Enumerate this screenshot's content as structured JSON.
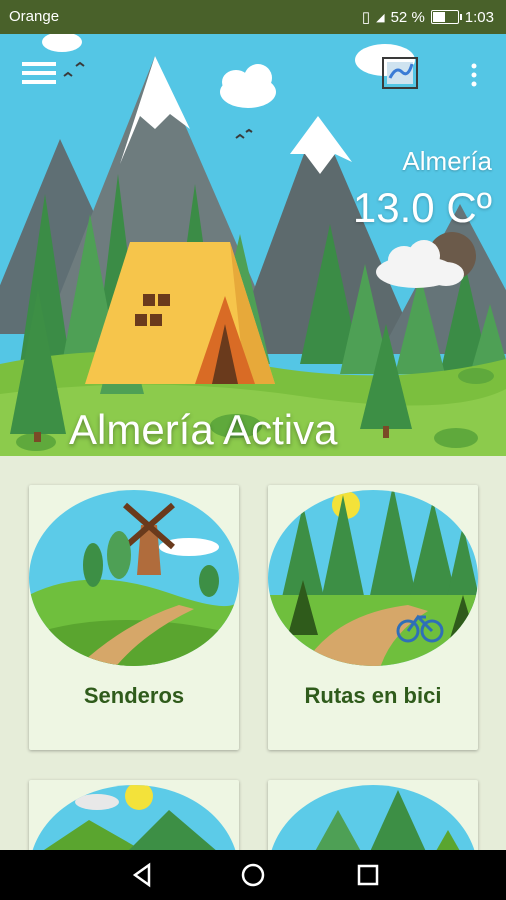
{
  "status_bar": {
    "carrier": "Orange",
    "battery": "52 %",
    "time": "1:03"
  },
  "header": {
    "city": "Almería",
    "temperature": "13.0 Cº",
    "title": "Almería Activa"
  },
  "cards": [
    {
      "label": "Senderos"
    },
    {
      "label": "Rutas en bici"
    },
    {
      "label": ""
    },
    {
      "label": ""
    }
  ],
  "icons": {
    "menu": "menu-icon",
    "map": "map-icon",
    "more": "more-vert-icon",
    "weather": "cloudy-night-icon"
  },
  "colors": {
    "status_bar": "#49612a",
    "sky": "#54c6e5",
    "grass": "#7bbf3e",
    "card_bg": "#eef6e3",
    "card_text": "#2f5b1b",
    "page_bg": "#e6edd9"
  }
}
